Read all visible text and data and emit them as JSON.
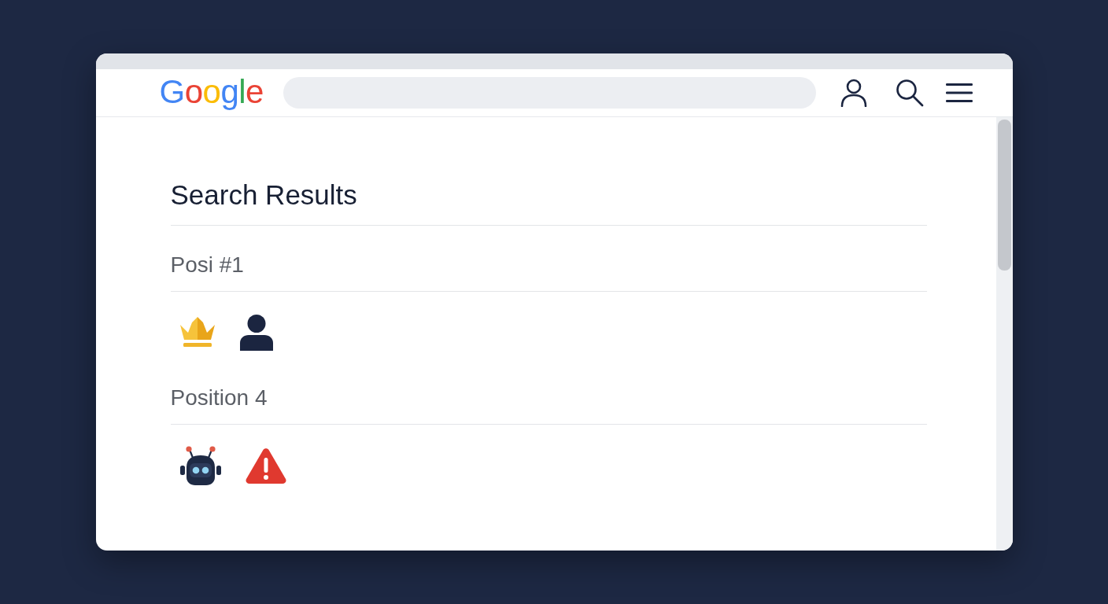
{
  "header": {
    "logo": "Google"
  },
  "results": {
    "title": "Search Results",
    "sections": [
      {
        "label": "Posi #1"
      },
      {
        "label": "Position 4"
      }
    ]
  }
}
